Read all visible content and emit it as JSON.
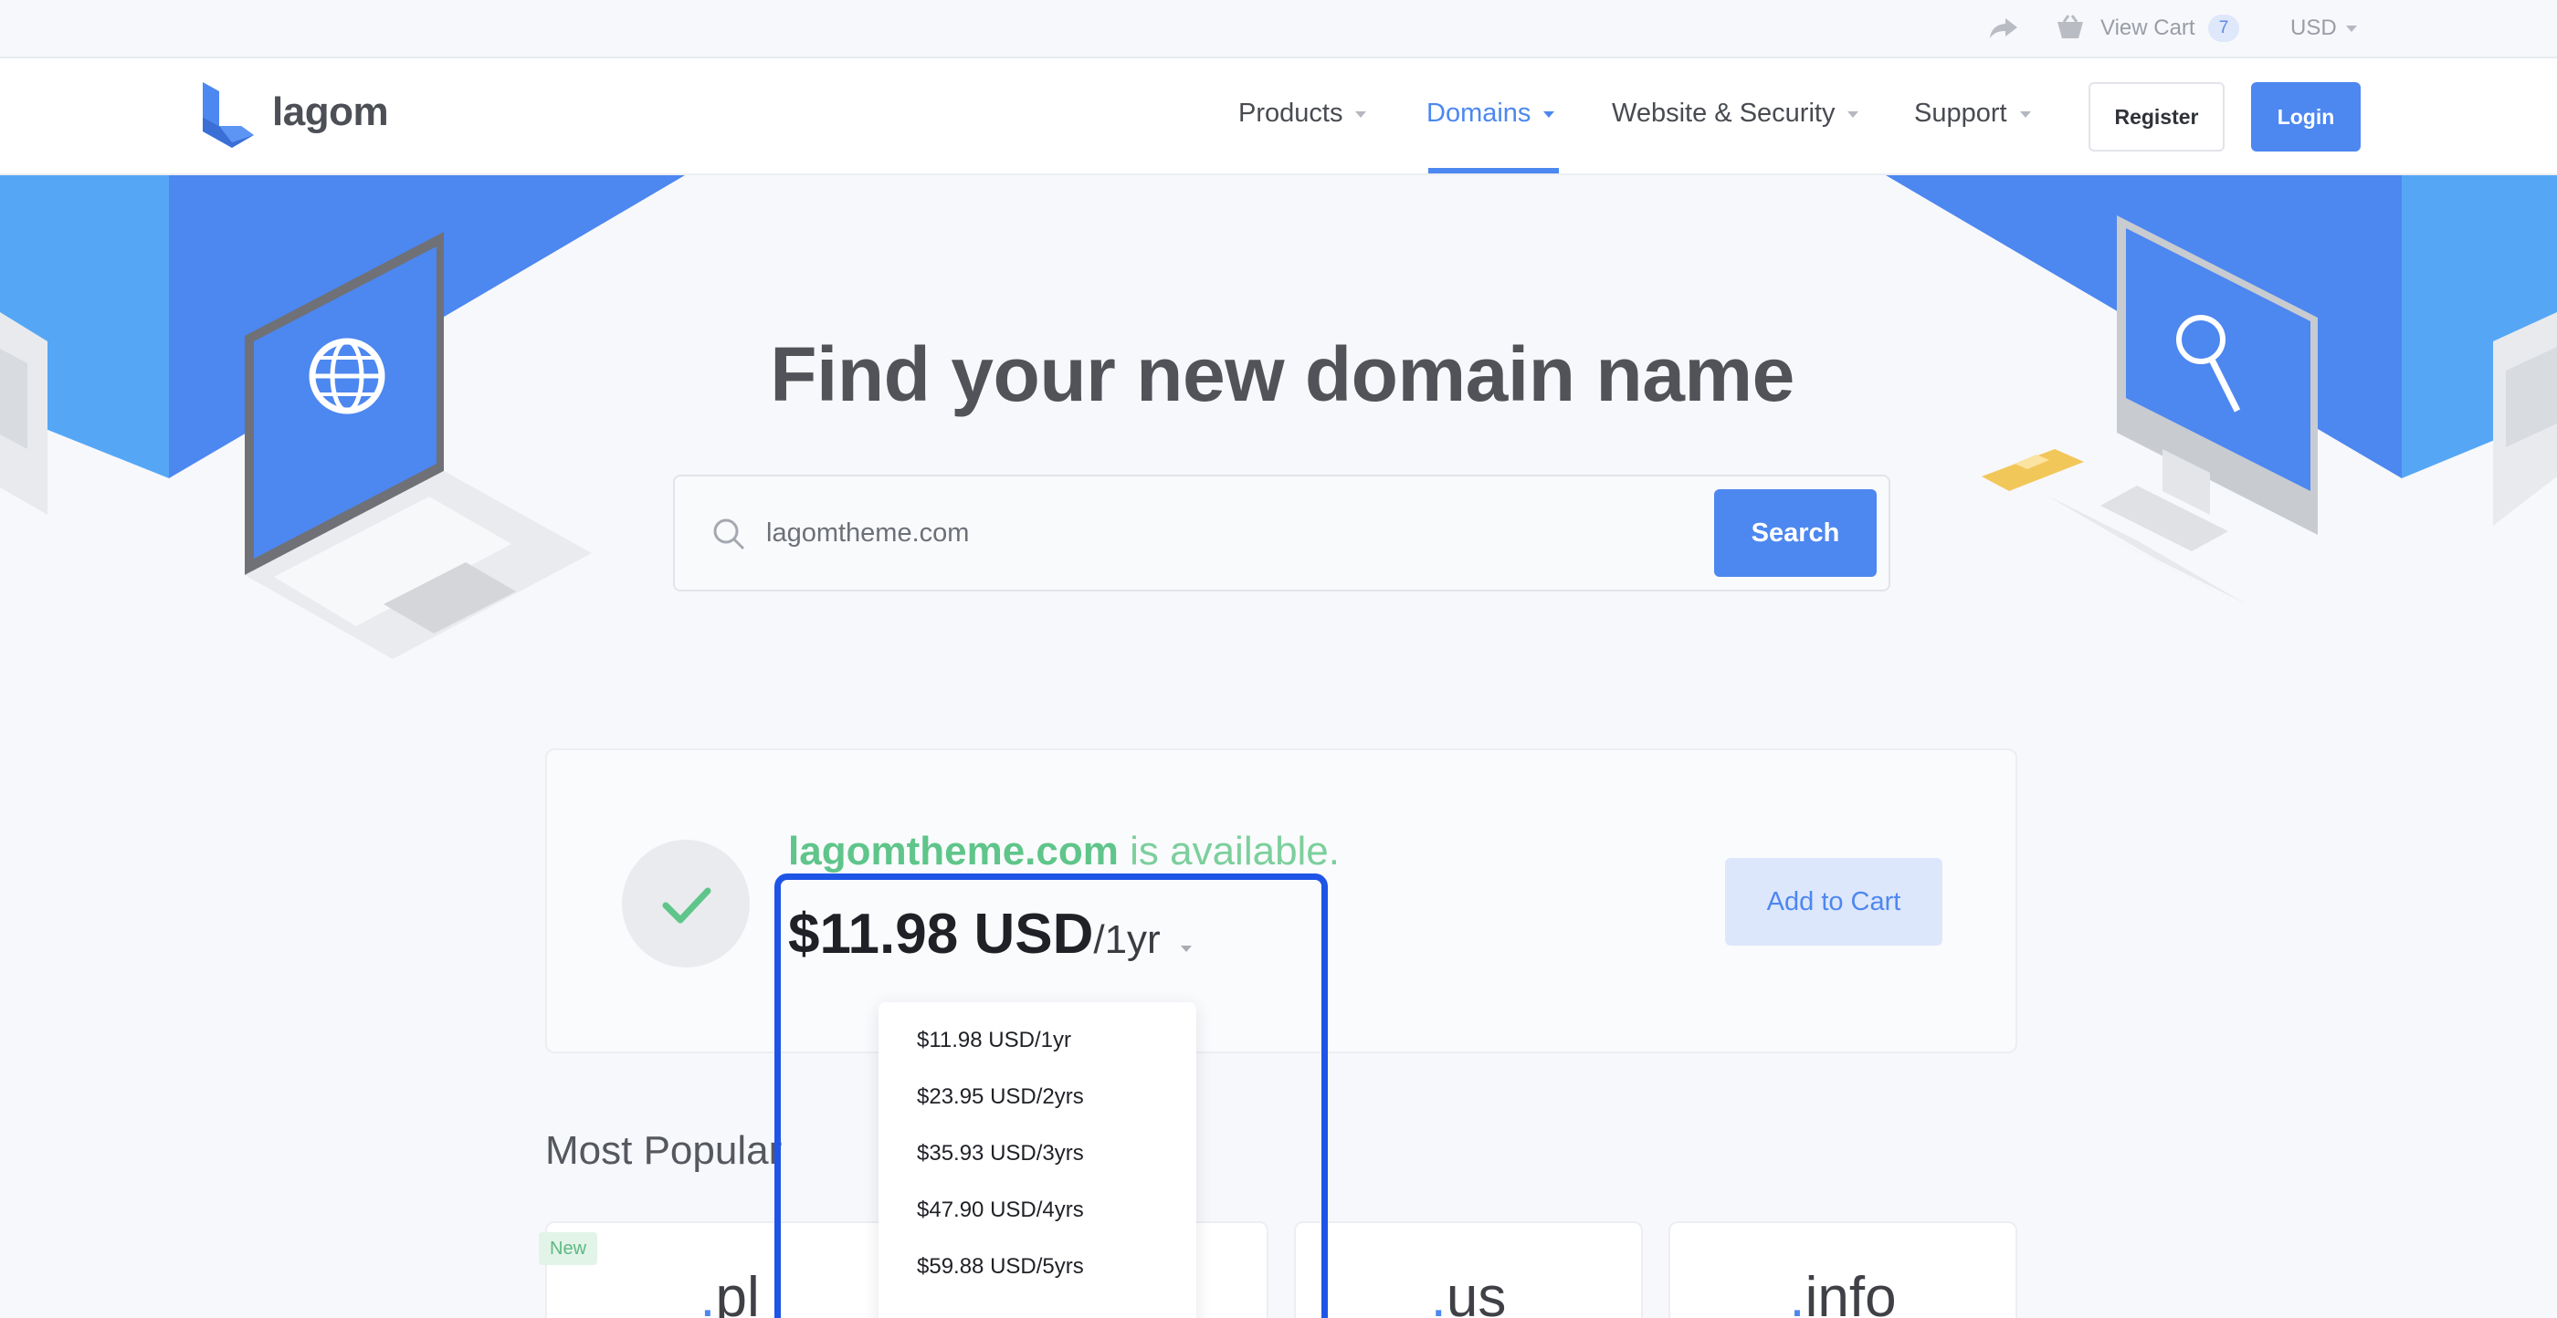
{
  "topbar": {
    "share_icon": "share-arrow-icon",
    "cart_icon": "basket-icon",
    "cart_label": "View Cart",
    "cart_count": "7",
    "currency": "USD"
  },
  "nav": {
    "logo_text": "lagom",
    "items": [
      {
        "label": "Products"
      },
      {
        "label": "Domains"
      },
      {
        "label": "Website & Security"
      },
      {
        "label": "Support"
      }
    ],
    "register": "Register",
    "login": "Login"
  },
  "hero": {
    "title": "Find your new domain name",
    "search_value": "lagomtheme.com",
    "search_button": "Search"
  },
  "result": {
    "domain": "lagomtheme.com",
    "status_text": " is available.",
    "price": "$11.98 USD",
    "period": "/1yr",
    "add_to_cart": "Add to Cart"
  },
  "price_options": [
    "$11.98 USD/1yr",
    "$23.95 USD/2yrs",
    "$35.93 USD/3yrs",
    "$47.90 USD/4yrs",
    "$59.88 USD/5yrs"
  ],
  "popular": {
    "title": "Most Popular",
    "badge": "New",
    "tlds": [
      {
        "name": "pl"
      },
      {
        "name": "us"
      },
      {
        "name": "info"
      }
    ]
  },
  "colors": {
    "accent": "#4d87f0",
    "available": "#5fc58a",
    "highlight": "#1e55e6"
  }
}
